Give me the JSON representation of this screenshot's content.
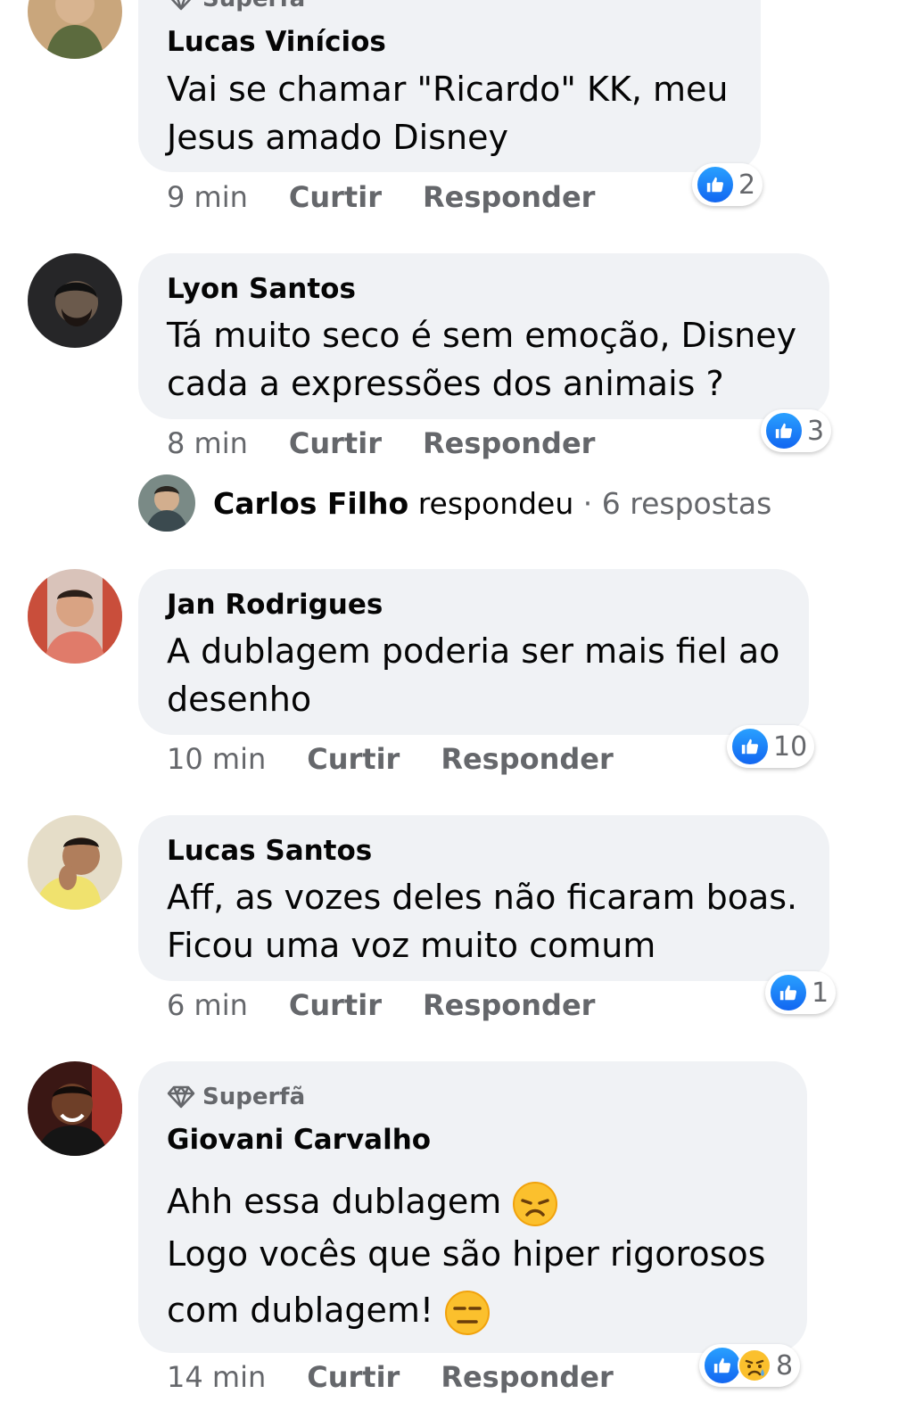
{
  "comments": [
    {
      "badge": "Superfã",
      "author": "Lucas Vinícios",
      "lines": [
        "Vai se chamar \"Ricardo\" KK, meu",
        "Jesus amado Disney"
      ],
      "time": "9 min",
      "like_label": "Curtir",
      "reply_label": "Responder",
      "reaction_count": "2"
    },
    {
      "author": "Lyon Santos",
      "lines": [
        "Tá muito seco é sem emoção, Disney",
        "cada a expressões dos animais ?"
      ],
      "time": "8 min",
      "like_label": "Curtir",
      "reply_label": "Responder",
      "reaction_count": "3",
      "replies": {
        "name": "Carlos Filho",
        "verb": "respondeu",
        "rest": "· 6 respostas"
      }
    },
    {
      "author": "Jan Rodrigues",
      "lines": [
        "A dublagem poderia ser mais fiel ao",
        "desenho"
      ],
      "time": "10 min",
      "like_label": "Curtir",
      "reply_label": "Responder",
      "reaction_count": "10"
    },
    {
      "author": "Lucas Santos",
      "lines": [
        "Aff, as vozes deles não ficaram boas.",
        "Ficou uma voz muito comum"
      ],
      "time": "6 min",
      "like_label": "Curtir",
      "reply_label": "Responder",
      "reaction_count": "1"
    },
    {
      "badge": "Superfã",
      "author": "Giovani Carvalho",
      "lines": [
        "Ahh essa dublagem",
        "Logo vocês que são hiper rigorosos",
        "com dublagem!"
      ],
      "emojis": [
        "disappointed-face",
        "expressionless-face"
      ],
      "time": "14 min",
      "like_label": "Curtir",
      "reply_label": "Responder",
      "reaction_count": "8",
      "reaction_icons": [
        "like",
        "sad"
      ]
    }
  ],
  "colors": {
    "bubble": "#f0f2f5",
    "meta_text": "#65676b",
    "like_blue": "#1877f2"
  }
}
